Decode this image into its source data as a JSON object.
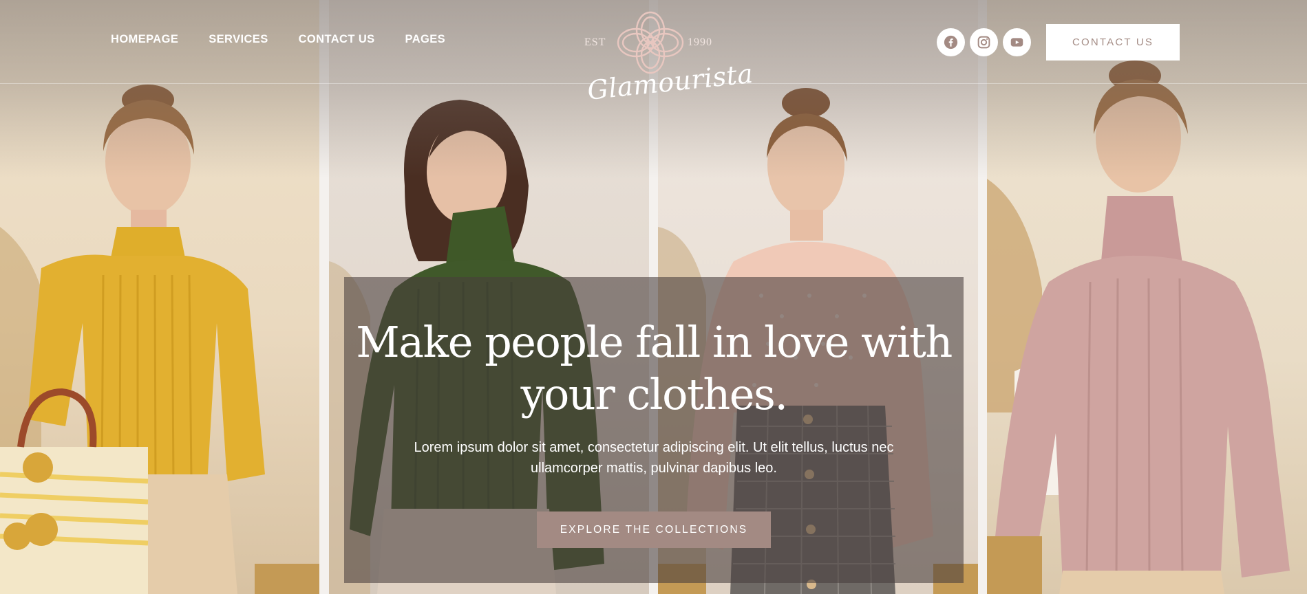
{
  "nav": {
    "items": [
      {
        "label": "HOMEPAGE"
      },
      {
        "label": "SERVICES"
      },
      {
        "label": "CONTACT US"
      },
      {
        "label": "PAGES"
      }
    ]
  },
  "logo": {
    "est": "EST",
    "year": "1990",
    "name": "Glamourista"
  },
  "socials": [
    {
      "icon": "facebook-icon"
    },
    {
      "icon": "instagram-icon"
    },
    {
      "icon": "youtube-icon"
    }
  ],
  "header": {
    "contact_label": "CONTACT US"
  },
  "hero": {
    "title_line1": "Make people fall in love with",
    "title_line2": "your clothes.",
    "text_line1": "Lorem ipsum dolor sit amet, consectetur adipiscing elit. Ut elit tellus, luctus nec",
    "text_line2": "ullamcorper mattis, pulvinar dapibus leo.",
    "button_label": "EXPLORE THE COLLECTIONS"
  },
  "colors": {
    "accent": "#a38a83",
    "overlay": "#483e3c",
    "text_light": "#ffffff"
  }
}
